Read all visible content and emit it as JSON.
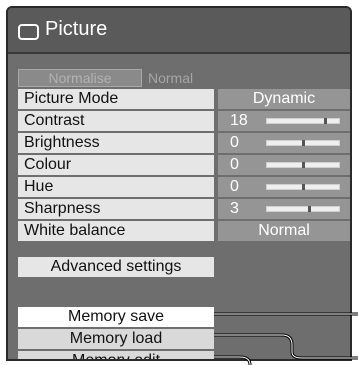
{
  "window": {
    "title": "Picture",
    "icon": "display-screen-icon"
  },
  "normalise": {
    "button_label": "Normalise",
    "status": "Normal"
  },
  "settings": [
    {
      "label": "Picture Mode",
      "value": "Dynamic"
    },
    {
      "label": "Contrast",
      "value": "18",
      "level": 0.82
    },
    {
      "label": "Brightness",
      "value": "0",
      "level": 0.5
    },
    {
      "label": "Colour",
      "value": "0",
      "level": 0.5
    },
    {
      "label": "Hue",
      "value": "0",
      "level": 0.5
    },
    {
      "label": "Sharpness",
      "value": "3",
      "level": 0.6
    },
    {
      "label": "White balance",
      "value": "Normal"
    }
  ],
  "advanced": {
    "label": "Advanced settings"
  },
  "memory": {
    "save_label": "Memory save",
    "load_label": "Memory load",
    "edit_label": "Memory edit"
  },
  "colors": {
    "panel_bg": "#6e6e6e",
    "label_bg": "#e6e6e6",
    "value_bg": "#959595",
    "selected_bg": "#ffffff"
  }
}
